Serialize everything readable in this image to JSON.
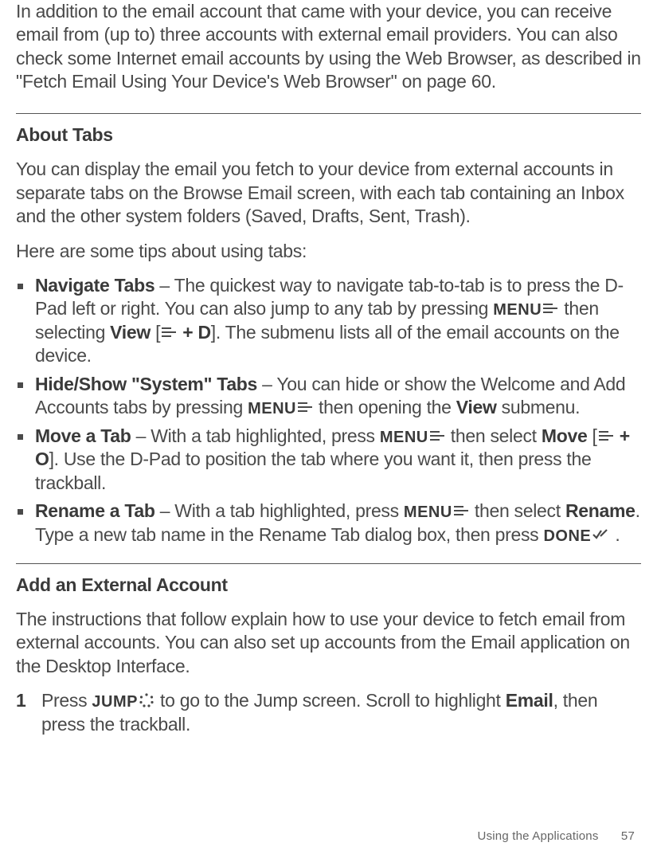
{
  "intro": "In addition to the email account that came with your device, you can receive email from (up to) three accounts with external email providers. You can also check some Internet email accounts by using the Web Browser, as described in \"Fetch Email Using Your Device's Web Browser\" on page 60.",
  "sections": {
    "about_tabs": {
      "heading": "About Tabs",
      "para1": "You can display the email you fetch to your device from external accounts in separate tabs on the Browse Email screen, with each tab containing an Inbox and the other system folders (Saved, Drafts, Sent, Trash).",
      "para2": "Here are some tips about using tabs:",
      "bullets": {
        "b1": {
          "label": "Navigate Tabs",
          "t1": " – The quickest way to navigate tab-to-tab is to press the D-Pad left or right. You can also jump to any tab by pressing ",
          "menu": "MENU",
          "t2": " then selecting ",
          "view": "View",
          "t3": " [",
          "shortcut": " + D",
          "t4": "]. The submenu lists all of the email accounts on the device."
        },
        "b2": {
          "label": "Hide/Show \"System\" Tabs",
          "t1": " – You can hide or show the Welcome and Add Accounts tabs by pressing ",
          "menu": "MENU",
          "t2": " then opening the ",
          "view": "View",
          "t3": " submenu."
        },
        "b3": {
          "label": "Move a Tab",
          "t1": " – With a tab highlighted, press ",
          "menu": "MENU",
          "t2": " then select ",
          "move": "Move",
          "t3": " [",
          "shortcut": " + O",
          "t4": "]. Use the D-Pad to position the tab where you want it, then press the trackball."
        },
        "b4": {
          "label": "Rename a Tab",
          "t1": " – With a tab highlighted, press ",
          "menu": "MENU",
          "t2": " then select ",
          "rename": "Rename",
          "t3": ". Type a new tab name in the Rename Tab dialog box, then press ",
          "done": "DONE",
          "t4": " ."
        }
      }
    },
    "add_external": {
      "heading": "Add an External Account",
      "para1": "The instructions that follow explain how to use your device to fetch email from external accounts. You can also set up accounts from the Email application on the Desktop Interface.",
      "step1": {
        "num": "1",
        "t1": "Press ",
        "jump": "JUMP",
        "t2": " to go to the Jump screen. Scroll to highlight ",
        "email": "Email",
        "t3": ", then press the trackball."
      }
    }
  },
  "footer": {
    "label": "Using the Applications",
    "page": "57"
  }
}
